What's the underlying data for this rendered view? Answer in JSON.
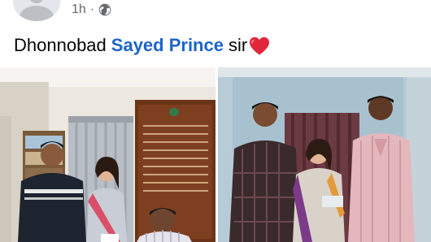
{
  "post": {
    "timestamp": "1h",
    "separator": "·",
    "privacy_icon": "globe-icon",
    "caption": {
      "prefix": "Dhonnobad",
      "mention": "Sayed Prince",
      "suffix": "sir",
      "emoji": "red-heart-emoji"
    },
    "photos": [
      {
        "name": "photo-office-group"
      },
      {
        "name": "photo-four-people-standing"
      }
    ]
  },
  "colors": {
    "mention": "#1b64c8",
    "meta_text": "#65676b",
    "heart": "#e0263a"
  }
}
